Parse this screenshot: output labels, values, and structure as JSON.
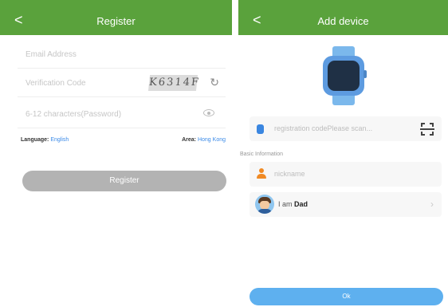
{
  "register_screen": {
    "back_glyph": "<",
    "title": "Register",
    "email_placeholder": "Email Address",
    "verification_placeholder": "Verification Code",
    "captcha_text": "K6314F",
    "password_placeholder": "6-12 characters(Password)",
    "language_label": "Language:",
    "language_value": "English",
    "area_label": "Area:",
    "area_value": "Hong Kong",
    "register_button": "Register"
  },
  "add_device_screen": {
    "back_glyph": "<",
    "title": "Add device",
    "registration_placeholder": "registration codePlease scan...",
    "section_label": "Basic Information",
    "nickname_placeholder": "nickname",
    "role_prefix": "I am",
    "role_value": "Dad",
    "ok_button": "Ok"
  },
  "icons": {
    "captcha_refresh": "refresh-icon",
    "password_visibility": "eye-icon",
    "device": "watch-icon",
    "registration_field": "device-icon",
    "scan": "scan-icon",
    "nickname_field": "person-icon",
    "role_avatar": "avatar-icon",
    "row_chevron": "chevron-right-icon"
  },
  "colors": {
    "header": "#5aa23c",
    "link": "#3c8be8",
    "register_button": "#b3b3b3",
    "ok_button": "#5eb0ef",
    "watch": "#5d9be0",
    "person_icon": "#f08a24"
  }
}
